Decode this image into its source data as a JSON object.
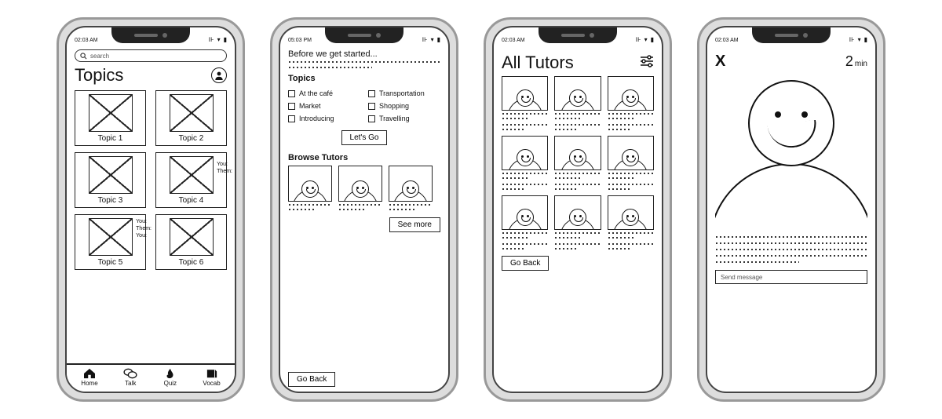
{
  "statusbar": {
    "time_a": "02:03 AM",
    "time_b": "05:03 PM",
    "signal": "⊪",
    "wifi": "▾",
    "battery": "▮"
  },
  "screen1": {
    "search_placeholder": "search",
    "title": "Topics",
    "topics": [
      "Topic 1",
      "Topic 2",
      "Topic 3",
      "Topic 4",
      "Topic 5",
      "Topic 6"
    ],
    "chat_labels": {
      "you": "You:",
      "them": "Them:"
    },
    "tabs": [
      "Home",
      "Talk",
      "Quiz",
      "Vocab"
    ]
  },
  "screen2": {
    "intro": "Before we get started...",
    "topics_heading": "Topics",
    "topic_options": [
      "At the café",
      "Transportation",
      "Market",
      "Shopping",
      "Introducing",
      "Travelling"
    ],
    "lets_go": "Let's Go",
    "browse_heading": "Browse Tutors",
    "see_more": "See more",
    "go_back": "Go Back"
  },
  "screen3": {
    "title": "All Tutors",
    "go_back": "Go Back"
  },
  "screen4": {
    "close": "X",
    "timer_value": "2",
    "timer_unit": "min",
    "send_placeholder": "Send message"
  }
}
